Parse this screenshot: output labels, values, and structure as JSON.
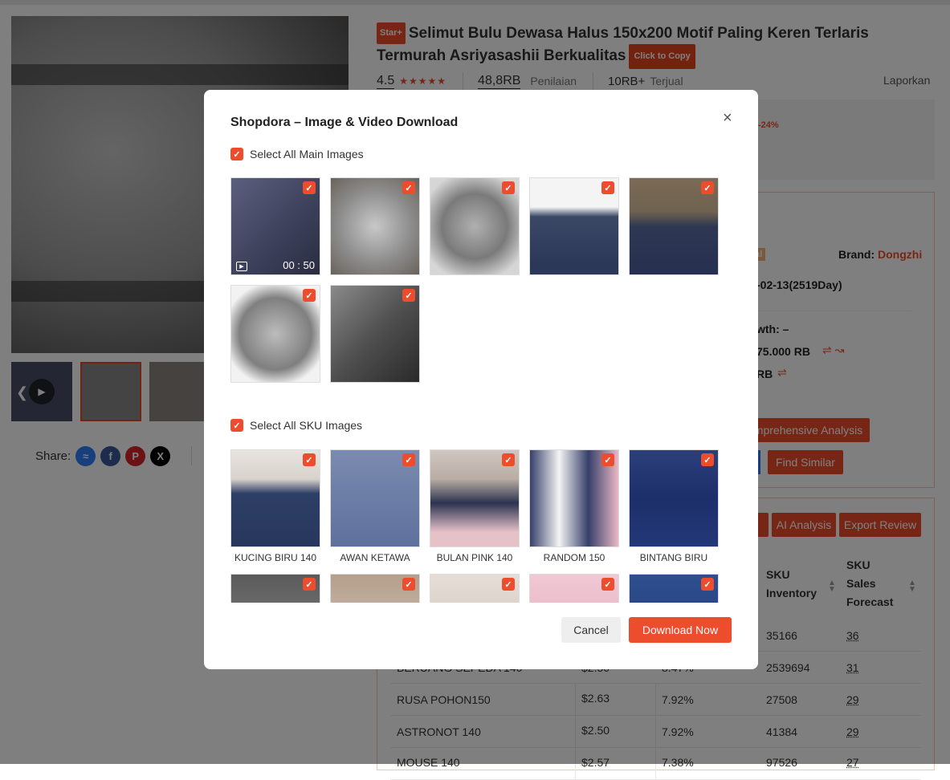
{
  "product": {
    "badge": "Star+",
    "title": "Selimut Bulu Dewasa Halus 150x200 Motif Paling Keren Terlaris Termurah Asriyasashii Berkualitas",
    "copy_label": "Click to Copy",
    "rating": "4.5",
    "reviews_count": "48,8RB",
    "reviews_label": "Penilaian",
    "sold_count": "10RB+",
    "sold_label": "Terjual",
    "report_label": "Laporkan",
    "discount": "-24%"
  },
  "share": {
    "label": "Share:",
    "icons": [
      "messenger-icon",
      "facebook-icon",
      "pinterest-icon",
      "x-icon"
    ]
  },
  "side_panel": {
    "local_tag": "cal",
    "brand_label": "Brand:",
    "brand_value": "Dongzhi",
    "listing_date": "-02-13(2519Day)",
    "growth": "wth: –",
    "sales_value": "75.000 RB",
    "revenue_value": "RB",
    "analysis_button": "mprehensive Analysis",
    "find_similar": "Find Similar"
  },
  "review_panel": {
    "ai_analysis": "AI Analysis",
    "export_review": "Export Review",
    "col_inventory": "SKU Inventory",
    "col_forecast": "SKU Sales Forecast",
    "rows": [
      {
        "name": "",
        "price": "",
        "pct": "",
        "inventory": "35166",
        "forecast": "36"
      },
      {
        "name": "BERUANG SEPEDA 140",
        "price": "$2.50",
        "pct": "8.47%",
        "inventory": "2539694",
        "forecast": "31"
      },
      {
        "name": "RUSA POHON150",
        "price": "$2.63",
        "pct": "7.92%",
        "inventory": "27508",
        "forecast": "29"
      },
      {
        "name": "ASTRONOT 140",
        "price": "$2.50",
        "pct": "7.92%",
        "inventory": "41384",
        "forecast": "29"
      },
      {
        "name": "MOUSE 140",
        "price": "$2.57",
        "pct": "7.38%",
        "inventory": "97526",
        "forecast": "27"
      }
    ]
  },
  "modal": {
    "title": "Shopdora – Image & Video Download",
    "select_main": "Select All Main Images",
    "video_duration": "00 : 50",
    "select_sku": "Select All SKU Images",
    "sku_captions": [
      "KUCING BIRU 140",
      "AWAN KETAWA",
      "BULAN PINK 140",
      "RANDOM 150",
      "BINTANG BIRU"
    ],
    "cancel": "Cancel",
    "download": "Download Now"
  },
  "colors": {
    "accent": "#ee4d2d",
    "overlay": "rgba(0,0,0,0.5)"
  }
}
